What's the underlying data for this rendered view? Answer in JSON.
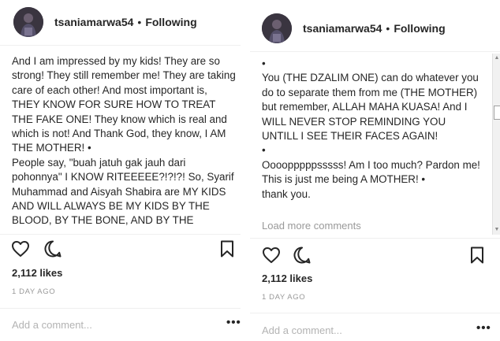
{
  "left": {
    "username": "tsaniamarwa54",
    "separator": "•",
    "follow_status": "Following",
    "caption": "And I am impressed by my kids! They are so strong! They still remember me! They are taking care of each other! And most important is, THEY KNOW FOR SURE HOW TO TREAT THE FAKE ONE! They know which is real and which is not! And Thank God, they know, I AM THE MOTHER! •\nPeople say, \"buah jatuh gak jauh dari pohonnya\" I KNOW RITEEEEE?!?!?! So, Syarif Muhammad and Aisyah Shabira are MY KIDS AND WILL ALWAYS BE MY KIDS BY THE BLOOD, BY THE BONE, AND BY THE UNCONDITIONAL LOVE!",
    "likes": "2,112 likes",
    "time": "1 DAY AGO",
    "comment_placeholder": "Add a comment...",
    "more_label": "•••"
  },
  "right": {
    "username": "tsaniamarwa54",
    "separator": "•",
    "follow_status": "Following",
    "caption": "•\nYou (THE DZALIM ONE) can do whatever you do to separate them from me (THE MOTHER) but remember, ALLAH MAHA KUASA! And I WILL NEVER STOP REMINDING YOU UNTILL I SEE THEIR FACES AGAIN!\n•\nOooopppppsssss! Am I too much? Pardon me! This is just me being A MOTHER! •\nthank you.",
    "load_more": "Load more comments",
    "likes": "2,112 likes",
    "time": "1 DAY AGO",
    "comment_placeholder": "Add a comment...",
    "more_label": "•••"
  },
  "icons": {
    "like": "heart-icon",
    "comment": "comment-bubble-icon",
    "save": "bookmark-icon"
  }
}
